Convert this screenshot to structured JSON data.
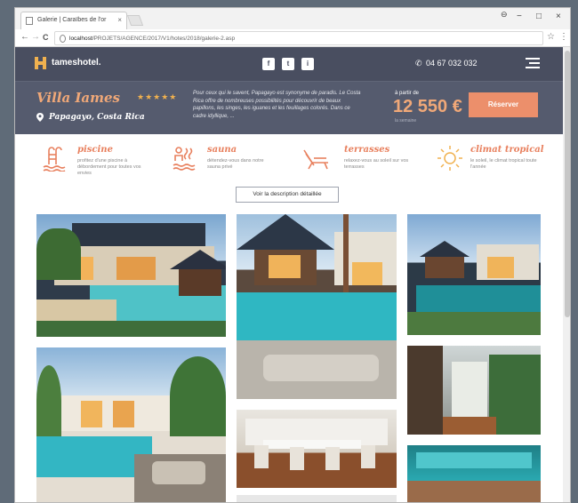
{
  "browser": {
    "tab_title": "Galerie | Caraïbes de l'or",
    "tab_close": "×",
    "window_controls": [
      "−",
      "□",
      "×"
    ],
    "url_host": "localhost/",
    "url_path": "PROJETS/AGENCE/2017/V1/hotes/2018/galerie-2.asp",
    "bookmark_glyph": "☆",
    "menu_glyph": "⋮",
    "back": "←",
    "forward": "→",
    "reload": "C"
  },
  "site": {
    "logo": "tameshotel.",
    "social": [
      "f",
      "t",
      "i"
    ],
    "phone": "04 67 032 032",
    "colors": {
      "nav": "#494e60",
      "hero": "#555b6e",
      "accent": "#ec8f6b",
      "gold": "#f0b14f"
    }
  },
  "hero": {
    "title": "Villa Iames",
    "stars": "★★★★★",
    "location": "Papagayo, Costa Rica",
    "description": "Pour ceux qui le savent, Papagayo est synonyme de paradis. Le Costa Rica offre de nombreuses possibilités pour découvrir de beaux papillons, les singes, les iguanes et les feuillages colorés. Dans ce cadre idyllique, ...",
    "from_label": "à partir de",
    "price": "12 550 €",
    "price_note": "la semaine",
    "reserve_label": "Réserver"
  },
  "features": [
    {
      "icon": "pool-ladder-icon",
      "title": "piscine",
      "desc": "profitez d'une piscine à débordement pour toutes vos envies"
    },
    {
      "icon": "sauna-icon",
      "title": "sauna",
      "desc": "détendez-vous dans notre sauna privé"
    },
    {
      "icon": "lounge-chair-icon",
      "title": "terrasses",
      "desc": "relaxez-vous au soleil sur vos terrasses"
    },
    {
      "icon": "sun-icon",
      "title": "climat tropical",
      "desc": "le soleil, le climat tropical toute l'année"
    }
  ],
  "detail_button": "Voir la description détaillée"
}
